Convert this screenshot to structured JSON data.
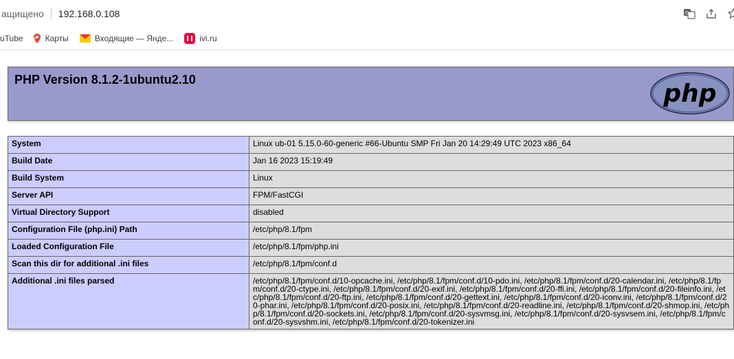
{
  "browser": {
    "security_label": "ащищено",
    "url": "192.168.0.108",
    "icons": [
      "translate-icon",
      "share-icon",
      "star-icon"
    ]
  },
  "bookmarks": [
    {
      "label": "uTube",
      "icon": "youtube-icon"
    },
    {
      "label": "Карты",
      "icon": "maps-pin-icon"
    },
    {
      "label": "Входящие — Янде...",
      "icon": "mail-icon"
    },
    {
      "label": "ivi.ru",
      "icon": "ivi-icon"
    }
  ],
  "php": {
    "title": "PHP Version 8.1.2-1ubuntu2.10",
    "logo_text": "php",
    "rows": [
      {
        "key": "System",
        "value": "Linux ub-01 5.15.0-60-generic #66-Ubuntu SMP Fri Jan 20 14:29:49 UTC 2023 x86_64"
      },
      {
        "key": "Build Date",
        "value": "Jan 16 2023 15:19:49"
      },
      {
        "key": "Build System",
        "value": "Linux"
      },
      {
        "key": "Server API",
        "value": "FPM/FastCGI"
      },
      {
        "key": "Virtual Directory Support",
        "value": "disabled"
      },
      {
        "key": "Configuration File (php.ini) Path",
        "value": "/etc/php/8.1/fpm"
      },
      {
        "key": "Loaded Configuration File",
        "value": "/etc/php/8.1/fpm/php.ini"
      },
      {
        "key": "Scan this dir for additional .ini files",
        "value": "/etc/php/8.1/fpm/conf.d"
      },
      {
        "key": "Additional .ini files parsed",
        "value": "/etc/php/8.1/fpm/conf.d/10-opcache.ini, /etc/php/8.1/fpm/conf.d/10-pdo.ini, /etc/php/8.1/fpm/conf.d/20-calendar.ini, /etc/php/8.1/fpm/conf.d/20-ctype.ini, /etc/php/8.1/fpm/conf.d/20-exif.ini, /etc/php/8.1/fpm/conf.d/20-ffi.ini, /etc/php/8.1/fpm/conf.d/20-fileinfo.ini, /etc/php/8.1/fpm/conf.d/20-ftp.ini, /etc/php/8.1/fpm/conf.d/20-gettext.ini, /etc/php/8.1/fpm/conf.d/20-iconv.ini, /etc/php/8.1/fpm/conf.d/20-phar.ini, /etc/php/8.1/fpm/conf.d/20-posix.ini, /etc/php/8.1/fpm/conf.d/20-readline.ini, /etc/php/8.1/fpm/conf.d/20-shmop.ini, /etc/php/8.1/fpm/conf.d/20-sockets.ini, /etc/php/8.1/fpm/conf.d/20-sysvmsg.ini, /etc/php/8.1/fpm/conf.d/20-sysvsem.ini, /etc/php/8.1/fpm/conf.d/20-sysvshm.ini, /etc/php/8.1/fpm/conf.d/20-tokenizer.ini"
      }
    ]
  },
  "colors": {
    "header_bg": "#9999cc",
    "key_bg": "#ccccff",
    "value_bg": "#dddddd"
  }
}
